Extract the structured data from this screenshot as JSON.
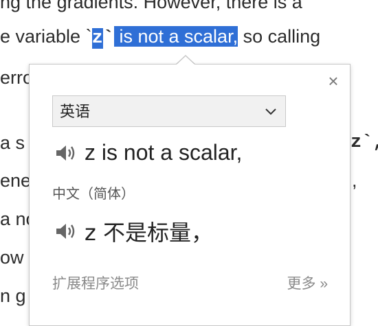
{
  "background_text": {
    "line1": "ng the gradients. However, there is a",
    "line2_before": "e variable `",
    "line2_code": "z",
    "line2_after_code": "`",
    "line2_highlight": " is not a scalar,",
    "line2_rest": " so calling",
    "line3": "erro",
    "line4_left": "a s",
    "line4_right": "z`,",
    "line5_left": "ene",
    "line5_right": ",",
    "line6_left": "a no",
    "line7_left": "ow",
    "line8_left": "n g"
  },
  "popup": {
    "close_label": "×",
    "source_language": "英语",
    "source_text": "z is not a scalar,",
    "target_language": "中文（简体）",
    "target_text": "z 不是标量，",
    "extension_options": "扩展程序选项",
    "more": "更多 »"
  },
  "colors": {
    "highlight": "#2f6fd6",
    "popup_border": "#c7c7c7"
  }
}
